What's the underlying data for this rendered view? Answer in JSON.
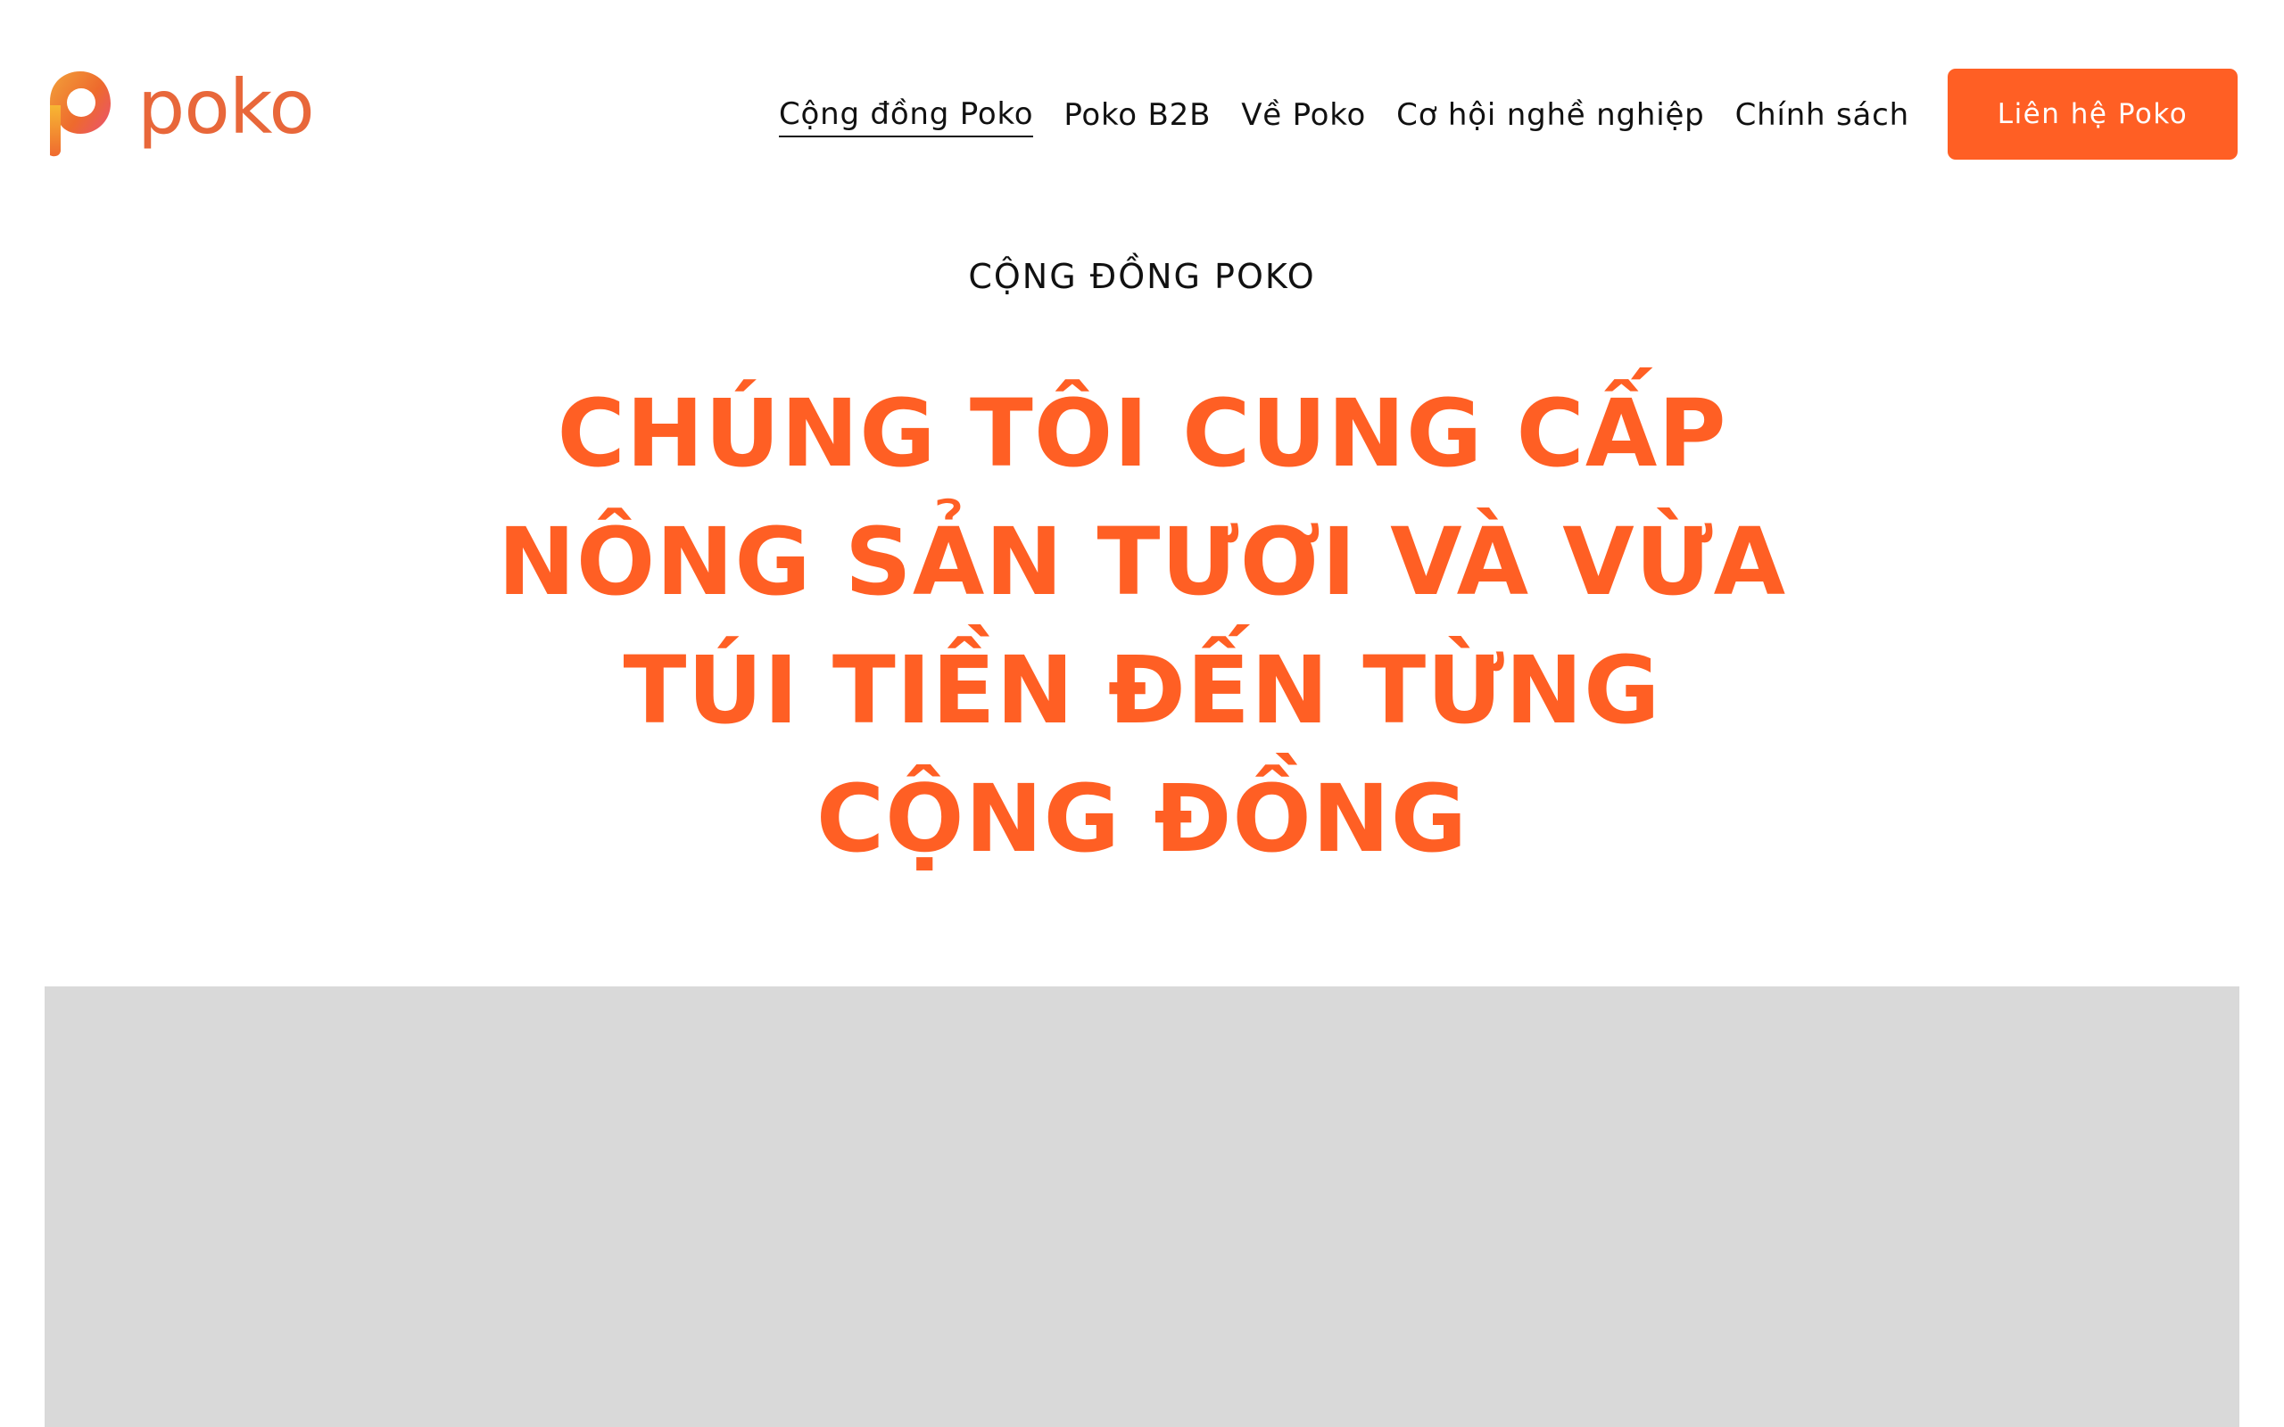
{
  "site": {
    "logo_text": "poko",
    "brand_color": "#ff5f24",
    "logo_color": "#e8673a"
  },
  "nav": {
    "items": [
      {
        "label": "Cộng đồng Poko",
        "active": true
      },
      {
        "label": "Poko B2B",
        "active": false
      },
      {
        "label": "Về Poko",
        "active": false
      },
      {
        "label": "Cơ hội nghề nghiệp",
        "active": false
      },
      {
        "label": "Chính sách",
        "active": false
      }
    ],
    "cta_label": "Liên hệ Poko"
  },
  "hero": {
    "eyebrow": "CỘNG ĐỒNG POKO",
    "headline_lines": [
      "CHÚNG TÔI CUNG CẤP",
      "NÔNG SẢN TƯƠI VÀ VỪA",
      "TÚI TIỀN ĐẾN TỪNG",
      "CỘNG ĐỒNG"
    ]
  },
  "media": {
    "placeholder_color": "#d9d9d9"
  }
}
